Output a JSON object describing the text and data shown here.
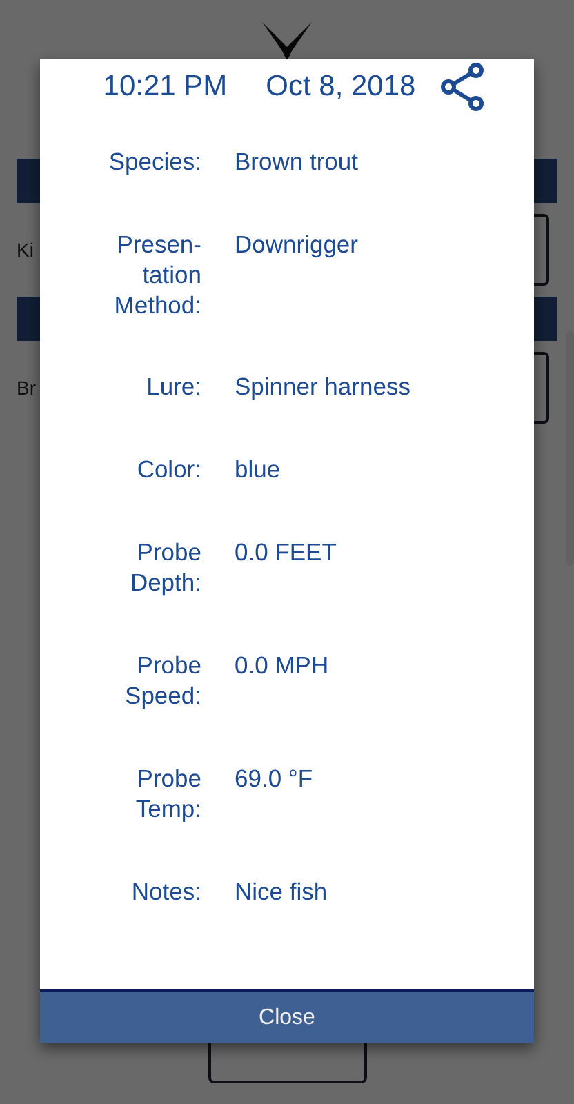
{
  "background": {
    "sections": [
      {
        "text": "Ki"
      },
      {
        "text": "Br"
      }
    ]
  },
  "dialog": {
    "time": "10:21 PM",
    "date": "Oct 8, 2018",
    "fields": [
      {
        "label": "Species:",
        "value": "Brown trout"
      },
      {
        "label": "Presen-\ntation\nMethod:",
        "value": "Downrigger"
      },
      {
        "label": "Lure:",
        "value": "Spinner harness"
      },
      {
        "label": "Color:",
        "value": "blue"
      },
      {
        "label": "Probe\nDepth:",
        "value": "0.0 FEET"
      },
      {
        "label": "Probe\nSpeed:",
        "value": "0.0 MPH"
      },
      {
        "label": "Probe\nTemp:",
        "value": "69.0 °F"
      },
      {
        "label": "Notes:",
        "value": "Nice fish"
      }
    ],
    "close_button": "Close"
  }
}
